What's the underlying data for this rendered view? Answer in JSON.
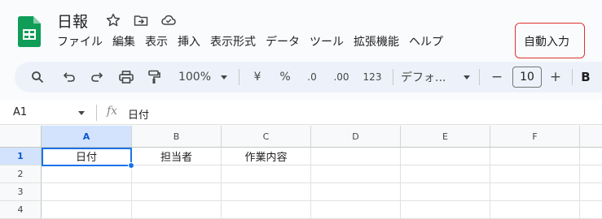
{
  "doc": {
    "title": "日報"
  },
  "menu": {
    "items": [
      "ファイル",
      "編集",
      "表示",
      "挿入",
      "表示形式",
      "データ",
      "ツール",
      "拡張機能",
      "ヘルプ"
    ],
    "highlighted": "自動入力"
  },
  "toolbar": {
    "zoom": "100%",
    "currency": "¥",
    "percent": "%",
    "decrease_decimal": ".0",
    "increase_decimal": ".00",
    "number_format": "123",
    "font": "デフォ...",
    "font_size": "10",
    "minus": "−",
    "plus": "+",
    "bold": "B"
  },
  "formula_bar": {
    "cell_ref": "A1",
    "content": "日付"
  },
  "sheet": {
    "columns": [
      "A",
      "B",
      "C",
      "D",
      "E",
      "F"
    ],
    "rows": [
      "1",
      "2",
      "3",
      "4"
    ],
    "cells": {
      "A1": "日付",
      "B1": "担当者",
      "C1": "作業内容"
    }
  },
  "colors": {
    "accent": "#1a73e8",
    "highlight_border": "#e0322a",
    "logo_green": "#0f9d58"
  }
}
